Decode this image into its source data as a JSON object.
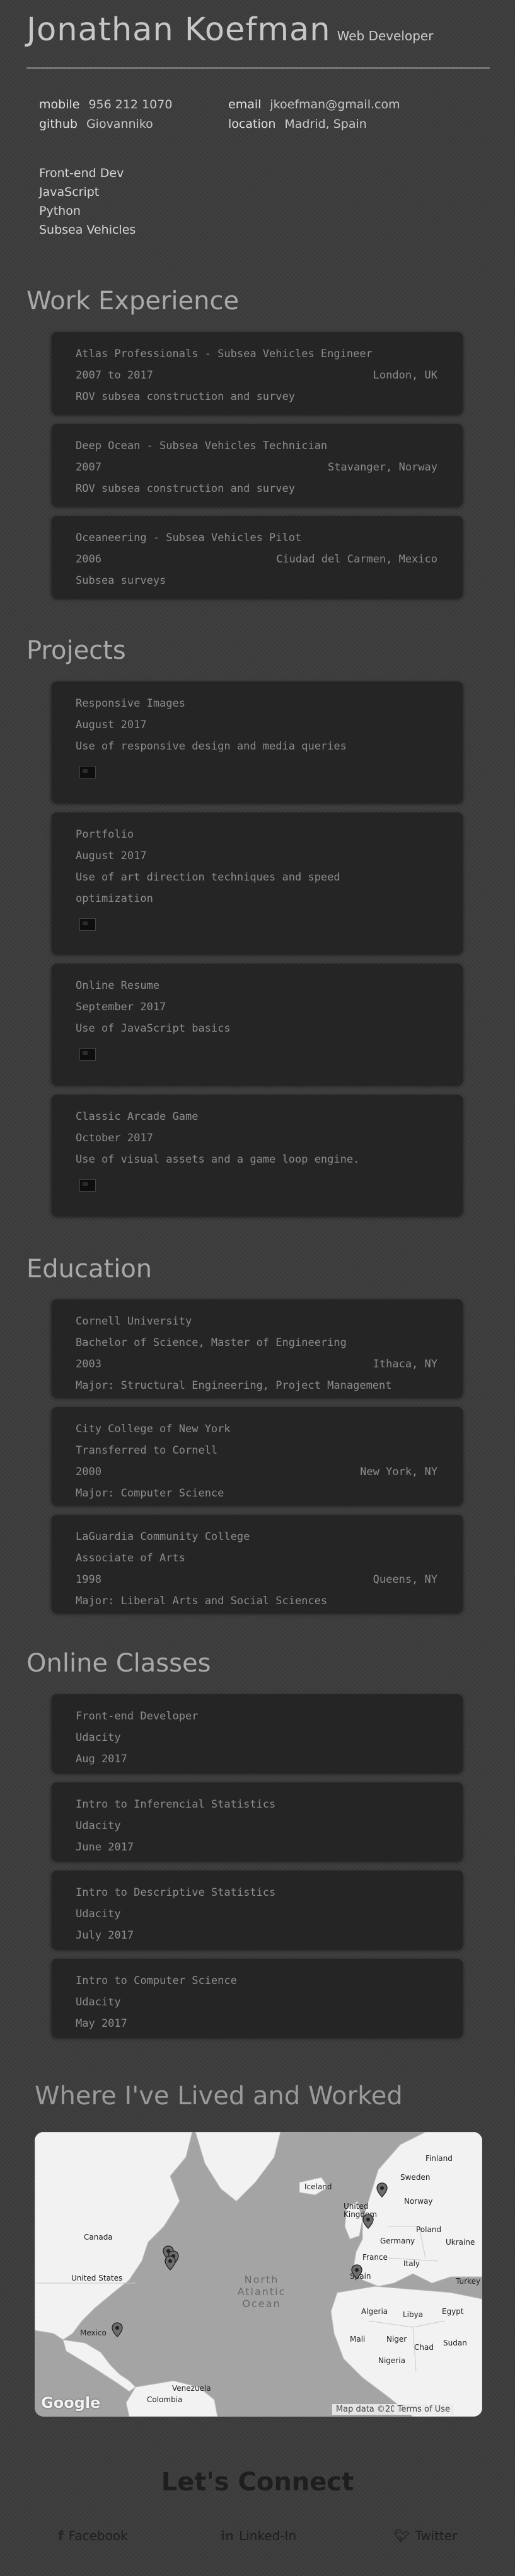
{
  "header": {
    "name": "Jonathan Koefman",
    "role": "Web Developer",
    "contacts": {
      "mobile_label": "mobile",
      "mobile": "956 212 1070",
      "github_label": "github",
      "github": "Giovanniko",
      "email_label": "email",
      "email": "jkoefman@gmail.com",
      "location_label": "location",
      "location": "Madrid, Spain"
    },
    "skills": [
      "Front-end Dev",
      "JavaScript",
      "Python",
      "Subsea Vehicles"
    ]
  },
  "work": {
    "title": "Work Experience",
    "items": [
      {
        "title": "Atlas Professionals - Subsea Vehicles Engineer",
        "dates": "2007 to 2017",
        "location": "London, UK",
        "description": "ROV subsea construction and survey"
      },
      {
        "title": "Deep Ocean - Subsea Vehicles Technician",
        "dates": "2007",
        "location": "Stavanger, Norway",
        "description": "ROV subsea construction and survey"
      },
      {
        "title": "Oceaneering - Subsea Vehicles Pilot",
        "dates": "2006",
        "location": "Ciudad del Carmen, Mexico",
        "description": "Subsea surveys"
      }
    ]
  },
  "projects": {
    "title": "Projects",
    "items": [
      {
        "title": "Responsive Images",
        "date": "August 2017",
        "description": "Use of responsive design and media queries"
      },
      {
        "title": "Portfolio",
        "date": "August 2017",
        "description_1": "Use of art direction techniques and speed",
        "description_2": "optimization"
      },
      {
        "title": "Online Resume",
        "date": "September 2017",
        "description": "Use of JavaScript basics"
      },
      {
        "title": "Classic Arcade Game",
        "date": "October 2017",
        "description": "Use of visual assets and a game loop engine."
      }
    ]
  },
  "education": {
    "title": "Education",
    "items": [
      {
        "school": "Cornell University",
        "degree": "Bachelor of Science, Master of Engineering",
        "date": "2003",
        "location": "Ithaca, NY",
        "major": "Major: Structural Engineering, Project Management"
      },
      {
        "school": "City College of New York",
        "degree": "Transferred to Cornell",
        "date": "2000",
        "location": "New York, NY",
        "major": "Major: Computer Science"
      },
      {
        "school": "LaGuardia Community College",
        "degree": "Associate of Arts",
        "date": "1998",
        "location": "Queens, NY",
        "major": "Major: Liberal Arts and Social Sciences"
      }
    ]
  },
  "online": {
    "title": "Online Classes",
    "items": [
      {
        "course": "Front-end Developer",
        "school": "Udacity",
        "date": "Aug 2017"
      },
      {
        "course": "Intro to Inferencial Statistics",
        "school": "Udacity",
        "date": "June 2017"
      },
      {
        "course": "Intro to Descriptive Statistics",
        "school": "Udacity",
        "date": "July 2017"
      },
      {
        "course": "Intro to Computer Science",
        "school": "Udacity",
        "date": "May 2017"
      }
    ]
  },
  "map": {
    "title": "Where I've Lived and Worked",
    "labels": {
      "canada": "Canada",
      "united_states": "United States",
      "mexico": "Mexico",
      "venezuela": "Venezuela",
      "colombia": "Colombia",
      "iceland": "Iceland",
      "finland": "Finland",
      "sweden": "Sweden",
      "united_kingdom": "United Kingdom",
      "germany": "Germany",
      "poland": "Poland",
      "ukraine": "Ukraine",
      "france": "France",
      "italy": "Italy",
      "spain": "Spain",
      "turkey": "Turkey",
      "algeria": "Algeria",
      "libya": "Libya",
      "egypt": "Egypt",
      "mali": "Mali",
      "niger": "Niger",
      "chad": "Chad",
      "sudan": "Sudan",
      "nigeria": "Nigeria",
      "norway": "Norway",
      "ocean": "North Atlantic Ocean"
    },
    "google": "Google",
    "data_credit": "Map data ©2017",
    "terms": "Terms of Use"
  },
  "connect": {
    "title": "Let's Connect",
    "facebook": "Facebook",
    "linkedin": "Linked-In",
    "twitter": "Twitter"
  }
}
